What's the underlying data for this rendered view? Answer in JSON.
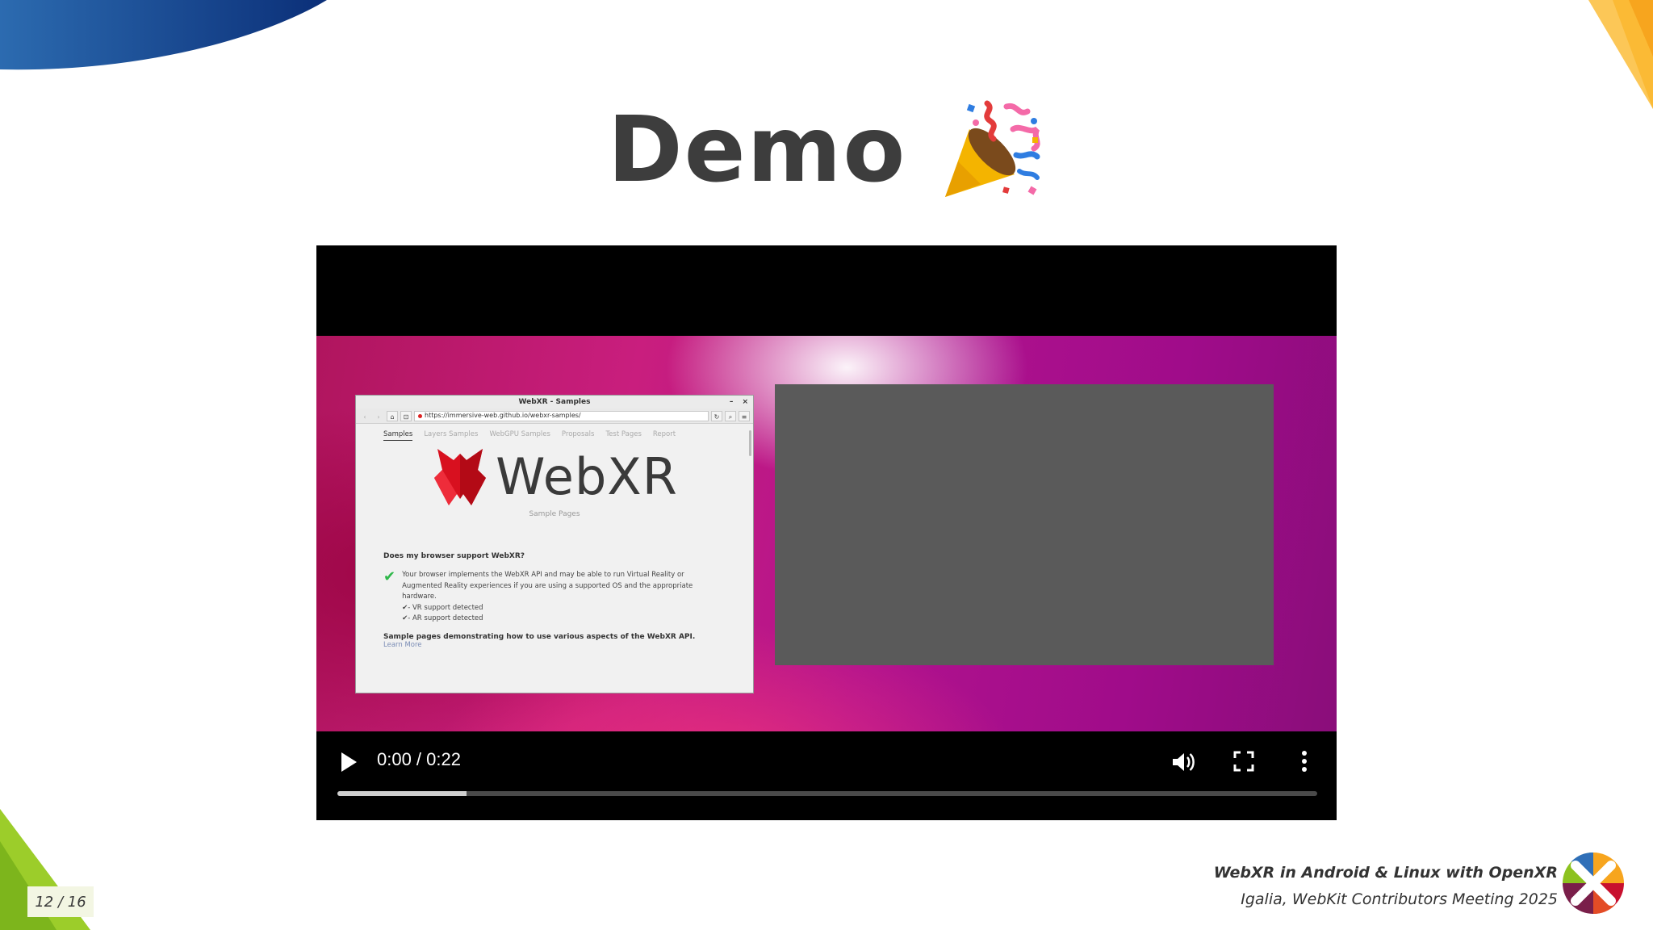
{
  "slide": {
    "title": "Demo",
    "page_current": "12",
    "page_separator": "/",
    "page_total": "16"
  },
  "footer": {
    "talk_title": "WebXR in Android & Linux with OpenXR",
    "event": "Igalia, WebKit Contributors Meeting 2025"
  },
  "video": {
    "time_display": "0:00 / 0:22",
    "progress_fraction": 0.132,
    "icons": [
      "play-icon",
      "volume-icon",
      "fullscreen-icon",
      "more-options-icon"
    ]
  },
  "browser": {
    "window_title": "WebXR - Samples",
    "window_controls": [
      "–",
      "×"
    ],
    "url": "https://immersive-web.github.io/webxr-samples/",
    "tabs": [
      {
        "label": "Samples",
        "active": true
      },
      {
        "label": "Layers Samples",
        "active": false
      },
      {
        "label": "WebGPU Samples",
        "active": false
      },
      {
        "label": "Proposals",
        "active": false
      },
      {
        "label": "Test Pages",
        "active": false
      },
      {
        "label": "Report",
        "active": false
      }
    ],
    "logo_text": "WebXR",
    "logo_subtitle": "Sample Pages",
    "question": "Does my browser support WebXR?",
    "support_lines": [
      "Your browser implements the WebXR API and may be able to run Virtual Reality or",
      "Augmented Reality experiences if you are using a supported OS and the appropriate",
      "hardware."
    ],
    "vr_support": "✔- VR support detected",
    "ar_support": "✔- AR support detected",
    "sample_desc": "Sample pages demonstrating how to use various aspects of the WebXR API.",
    "learn_more": "Learn More"
  },
  "colors": {
    "title": "#3d3d3d",
    "corner_blue": "#1f5aa0",
    "corner_orange": "#f7a51e",
    "corner_green": "#8cc21f",
    "video_progress": "#cfcfcf"
  }
}
